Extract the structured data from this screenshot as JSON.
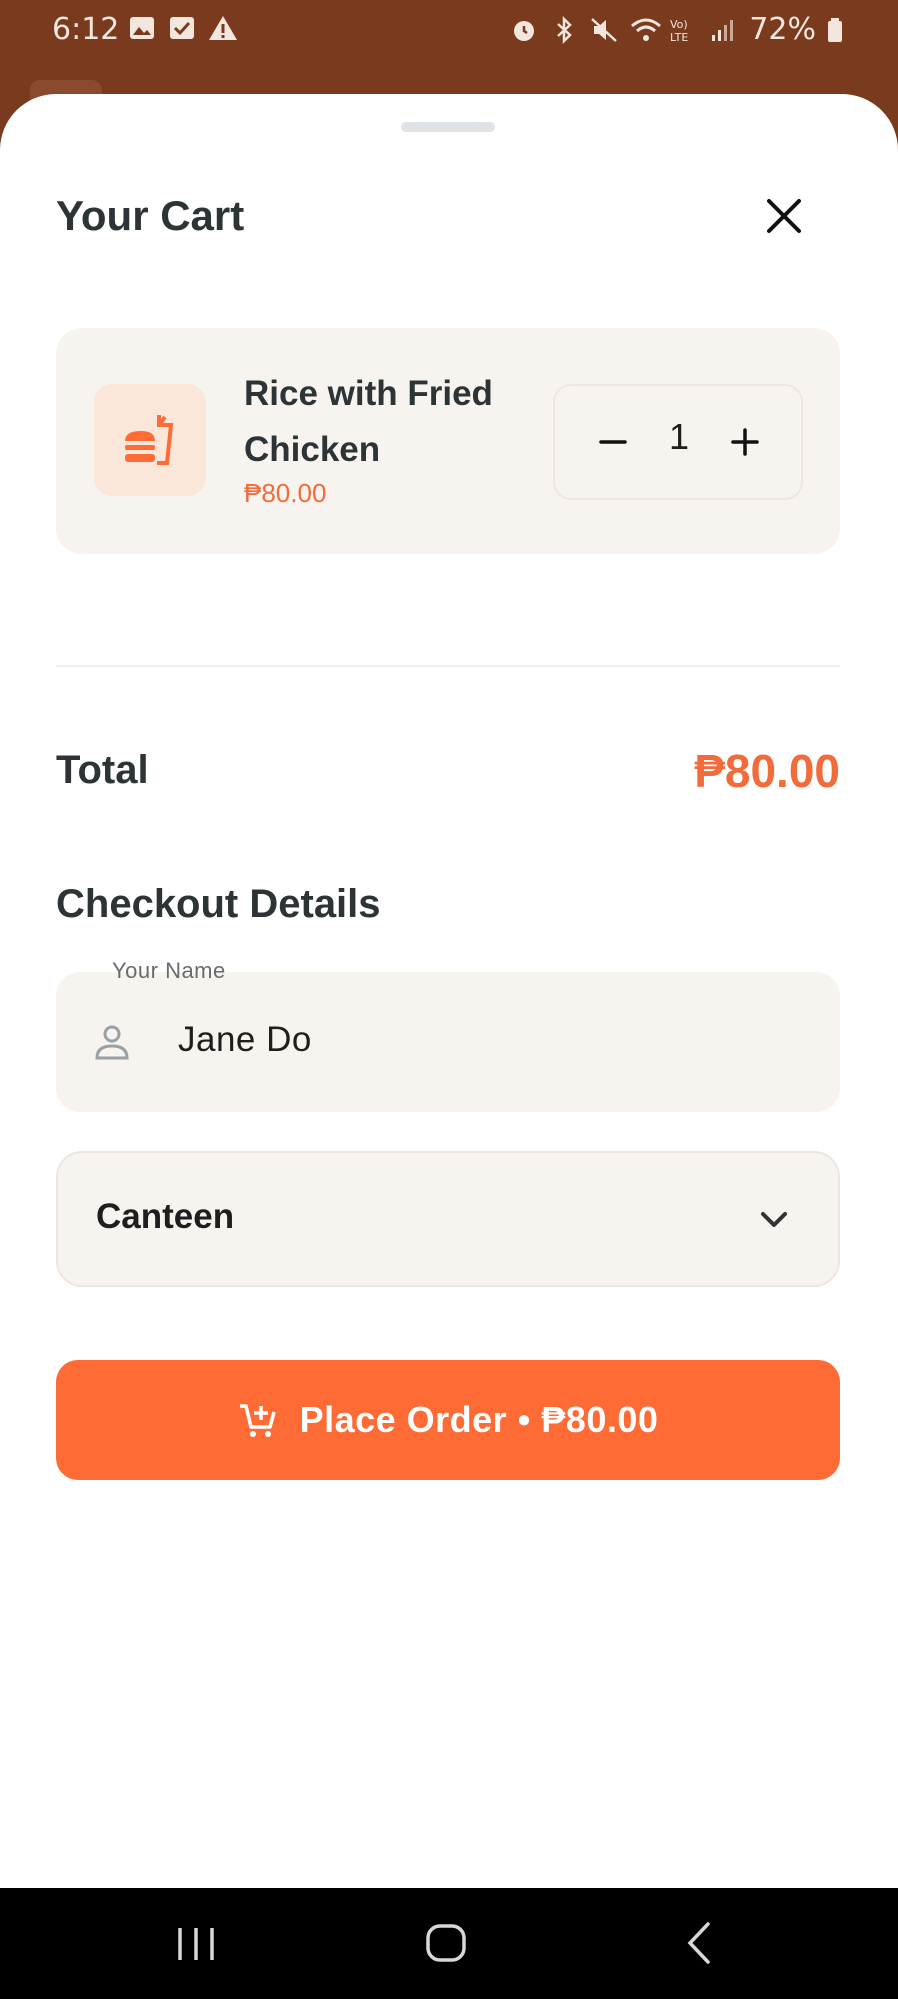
{
  "status_bar": {
    "time": "6:12",
    "battery": "72%",
    "left_icons": [
      "image-icon",
      "checkbox-icon",
      "warning-icon"
    ],
    "right_icons": [
      "alarm-icon",
      "bluetooth-icon",
      "mute-icon",
      "wifi-icon",
      "volte-icon",
      "signal-icon",
      "battery-icon"
    ]
  },
  "cart": {
    "title": "Your Cart",
    "items": [
      {
        "name": "Rice with Fried Chicken",
        "price": "₱80.00",
        "quantity": "1",
        "icon": "fastfood-icon"
      }
    ]
  },
  "total": {
    "label": "Total",
    "value": "₱80.00"
  },
  "checkout": {
    "title": "Checkout Details",
    "name_label": "Your Name",
    "name_value": "Jane Do",
    "location_value": "Canteen"
  },
  "order_button": {
    "label": "Place Order • ₱80.00",
    "icon": "cart-add-icon"
  },
  "colors": {
    "accent": "#ff6b35",
    "price_text": "#f26b3a",
    "card_bg": "#f7f3ee",
    "status_bg": "#7a3a1e"
  }
}
